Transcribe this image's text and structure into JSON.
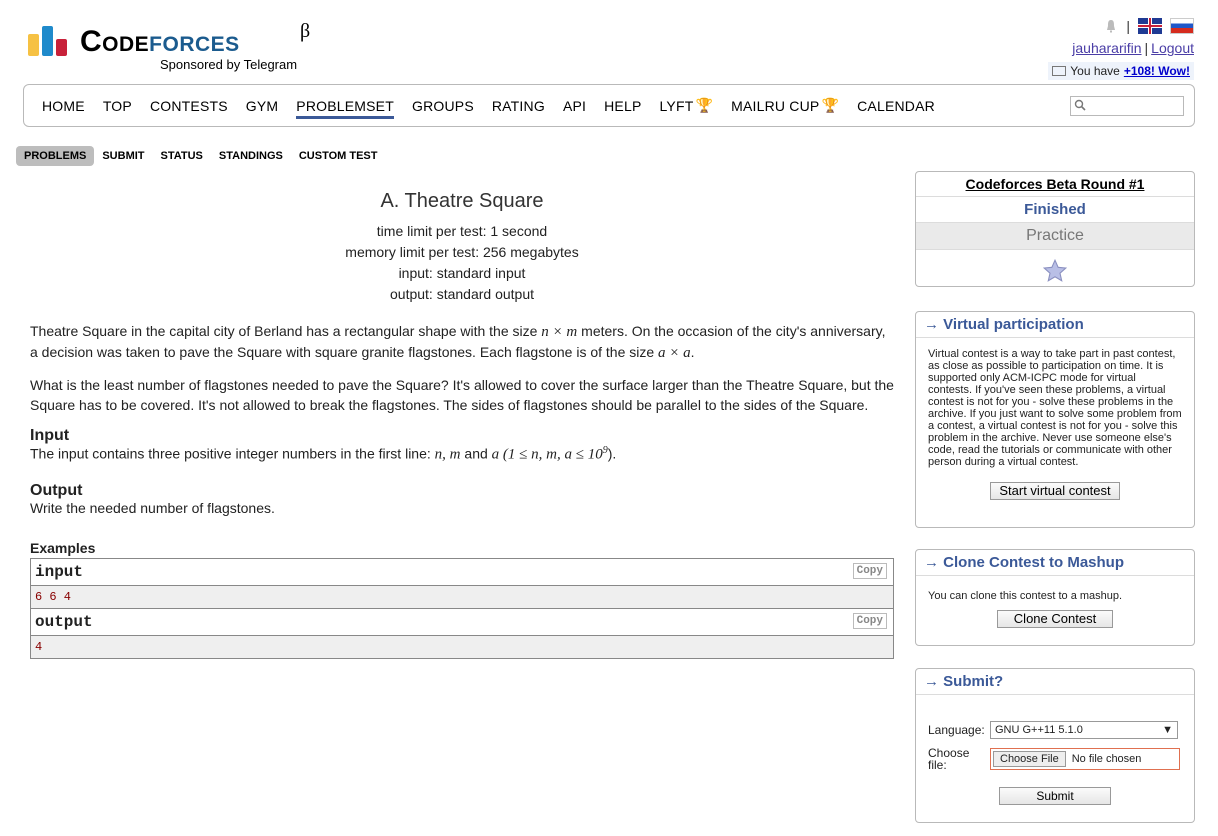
{
  "header": {
    "logo_code": "Code",
    "logo_forces": "forces",
    "logo_beta": "β",
    "sponsored": "Sponsored by Telegram",
    "separator": "|",
    "username": "jauhararifin",
    "logout": "Logout",
    "notice_prefix": "You have",
    "notice_link": "+108! Wow!"
  },
  "menu": {
    "items": [
      {
        "label": "Home"
      },
      {
        "label": "Top"
      },
      {
        "label": "Contests"
      },
      {
        "label": "Gym"
      },
      {
        "label": "Problemset"
      },
      {
        "label": "Groups"
      },
      {
        "label": "Rating"
      },
      {
        "label": "API"
      },
      {
        "label": "Help"
      },
      {
        "label": "Lyft"
      },
      {
        "label": "MailRu Cup"
      },
      {
        "label": "Calendar"
      }
    ]
  },
  "second_menu": {
    "items": [
      "Problems",
      "Submit",
      "Status",
      "Standings",
      "Custom test"
    ]
  },
  "problem": {
    "title": "A. Theatre Square",
    "time_limit": "time limit per test: 1 second",
    "memory_limit": "memory limit per test: 256 megabytes",
    "input": "input: standard input",
    "output": "output: standard output",
    "p1_a": "Theatre Square in the capital city of Berland has a rectangular shape with the size ",
    "p1_math1": "n × m",
    "p1_b": " meters. On the occasion of the city's anniversary, a decision was taken to pave the Square with square granite flagstones. Each flagstone is of the size ",
    "p1_math2": "a × a",
    "p1_c": ".",
    "p2": "What is the least number of flagstones needed to pave the Square? It's allowed to cover the surface larger than the Theatre Square, but the Square has to be covered. It's not allowed to break the flagstones. The sides of flagstones should be parallel to the sides of the Square.",
    "input_title": "Input",
    "input_a": "The input contains three positive integer numbers in the first line: ",
    "input_math1": "n,  m",
    "input_b": " and ",
    "input_math2": "a",
    "input_c": " (1 ≤  n, m, a ≤ 10",
    "input_sup": "9",
    "input_d": ").",
    "output_title": "Output",
    "output_body": "Write the needed number of flagstones.",
    "examples_title": "Examples",
    "ex_input_label": "input",
    "ex_input_value": "6 6 4",
    "ex_output_label": "output",
    "ex_output_value": "4",
    "copy_label": "Copy"
  },
  "sidebar": {
    "round_title": "Codeforces Beta Round #1",
    "round_status": "Finished",
    "round_mode": "Practice",
    "vp_title": "→ Virtual participation",
    "vp_body": "Virtual contest is a way to take part in past contest, as close as possible to participation on time. It is supported only ACM-ICPC mode for virtual contests. If you've seen these problems, a virtual contest is not for you - solve these problems in the archive. If you just want to solve some problem from a contest, a virtual contest is not for you - solve this problem in the archive. Never use someone else's code, read the tutorials or communicate with other person during a virtual contest.",
    "vp_button": "Start virtual contest",
    "clone_title": "→ Clone Contest to Mashup",
    "clone_body": "You can clone this contest to a mashup.",
    "clone_button": "Clone Contest",
    "submit_title": "→ Submit?",
    "language_label": "Language:",
    "language_value": "GNU G++11 5.1.0",
    "file_label": "Choose file:",
    "file_button": "Choose File",
    "file_status": "No file chosen",
    "submit_button": "Submit"
  }
}
